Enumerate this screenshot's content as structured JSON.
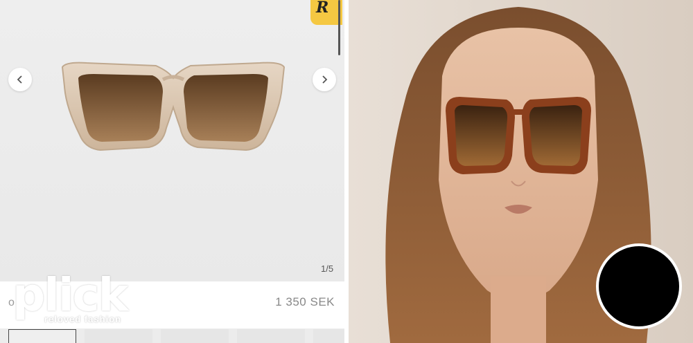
{
  "gallery": {
    "counter": "1/5",
    "prev_icon": "chevron-left-icon",
    "next_icon": "chevron-right-icon",
    "brand_badge_text": "R"
  },
  "product": {
    "name_fragment": "o F",
    "price": "1 350 SEK"
  },
  "watermark": {
    "logo": "plick",
    "tagline": "reloved fashion"
  },
  "colors": {
    "badge": "#f5c842",
    "frame_clear": "#d9c7b3",
    "lens_brown": "#6b4a2a",
    "frame_tortoise": "#8b3f1c"
  }
}
